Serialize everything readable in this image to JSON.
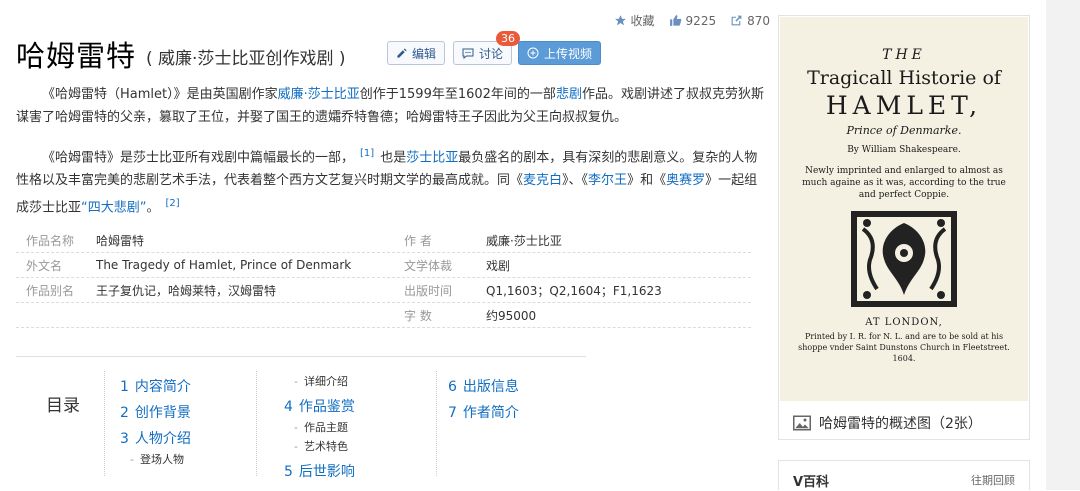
{
  "stats": {
    "favorite_label": "收藏",
    "likes": "9225",
    "shares": "870"
  },
  "title": {
    "main": "哈姆雷特",
    "sub": "( 威廉·莎士比亚创作戏剧 )"
  },
  "actions": {
    "edit": "编辑",
    "discuss": "讨论",
    "discuss_count": "36",
    "upload": "上传视频"
  },
  "para1": {
    "t1": "《哈姆雷特（Hamlet）》是由英国剧作家",
    "link1": "威廉·莎士比亚",
    "t2": "创作于1599年至1602年间的一部",
    "link2": "悲剧",
    "t3": "作品。戏剧讲述了叔叔克劳狄斯谋害了哈姆雷特的父亲，篡取了王位，并娶了国王的遗孀乔特鲁德；哈姆雷特王子因此为父王向叔叔复仇。"
  },
  "para2": {
    "t1": "《哈姆雷特》是莎士比亚所有戏剧中篇幅最长的一部，",
    "ref1": "[1]",
    "t2": "也是",
    "link1": "莎士比亚",
    "t3": "最负盛名的剧本，具有深刻的悲剧意义。复杂的人物性格以及丰富完美的悲剧艺术手法，代表着整个西方文艺复兴时期文学的最高成就。同《",
    "link2": "麦克白",
    "t4": "》、《",
    "link3": "李尔王",
    "t5": "》和《",
    "link4": "奥赛罗",
    "t6": "》一起组成莎士比亚",
    "link5": "“四大悲剧”",
    "t7": "。",
    "ref2": "[2]"
  },
  "info": [
    {
      "k": "作品名称",
      "v": "哈姆雷特",
      "k2": "作    者",
      "v2": "威廉·莎士比亚"
    },
    {
      "k": "外文名",
      "v": "The Tragedy of Hamlet, Prince of Denmark",
      "k2": "文学体裁",
      "v2": "戏剧"
    },
    {
      "k": "作品别名",
      "v": "王子复仇记，哈姆莱特，汉姆雷特",
      "k2": "出版时间",
      "v2": "Q1,1603；Q2,1604；F1,1623"
    },
    {
      "k": "",
      "v": "",
      "k2": "字    数",
      "v2": "约95000"
    }
  ],
  "toc": {
    "label": "目录",
    "col1": [
      {
        "n": "1",
        "t": "内容简介"
      },
      {
        "n": "2",
        "t": "创作背景"
      },
      {
        "n": "3",
        "t": "人物介绍"
      }
    ],
    "col1_sub": "登场人物",
    "col2_sub_top": "详细介绍",
    "col2": [
      {
        "n": "4",
        "t": "作品鉴赏"
      },
      {
        "n": "5",
        "t": "后世影响"
      }
    ],
    "col2_subs": [
      "作品主题",
      "艺术特色"
    ],
    "col3": [
      {
        "n": "6",
        "t": "出版信息"
      },
      {
        "n": "7",
        "t": "作者简介"
      }
    ],
    "dash": "-"
  },
  "album": {
    "cover": {
      "line1": "THE",
      "line2": "Tragicall Historie of",
      "line3": "HAMLET,",
      "line4": "Prince of Denmarke.",
      "line5": "By William Shakespeare.",
      "line6": "Newly imprinted and enlarged to almost as much againe as it was, according to the true and perfect Coppie.",
      "line7": "AT LONDON,",
      "line8": "Printed by I. R. for N. L. and are to be sold at his shoppe vnder Saint Dunstons Church in Fleetstreet. 1604."
    },
    "caption": "哈姆雷特的概述图（2张）"
  },
  "vbaike": {
    "title": "V百科",
    "link": "往期回顾"
  }
}
